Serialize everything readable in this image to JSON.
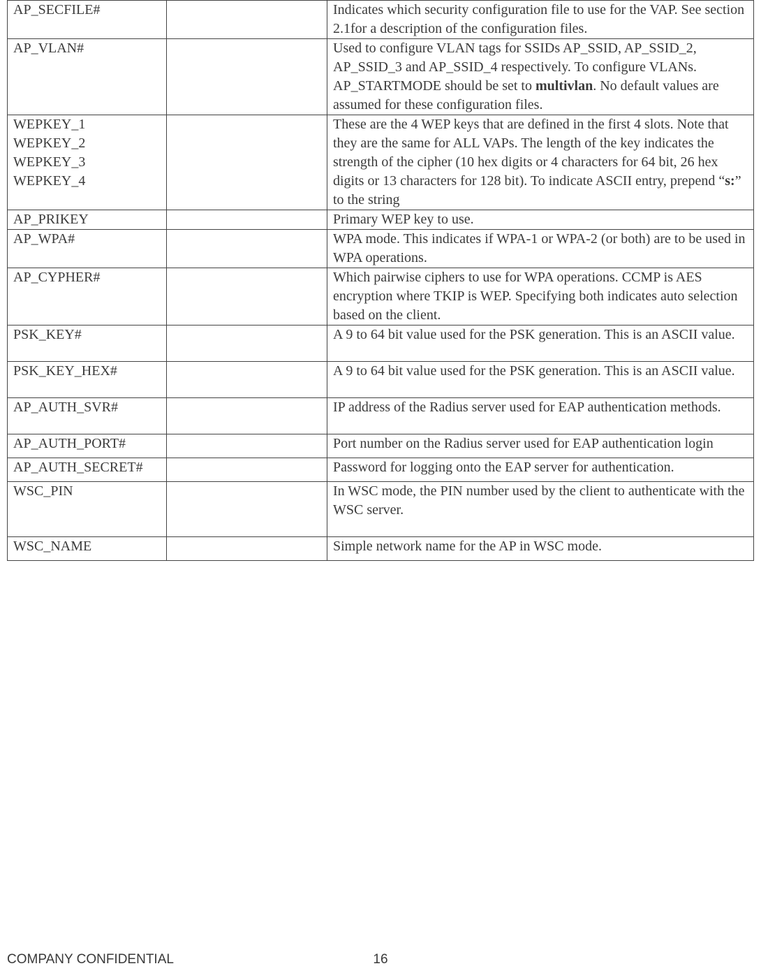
{
  "rows": [
    {
      "key": "AP_SECFILE#",
      "desc_html": "Indicates which security configuration file to use for the VAP. See section 2.1for a description of the configuration files."
    },
    {
      "key": "AP_VLAN#",
      "desc_html": "Used to configure VLAN tags for SSIDs AP_SSID, AP_SSID_2, AP_SSID_3 and AP_SSID_4 respectively. To configure VLANs. AP_STARTMODE should be set to <span class=\"bold\">multivlan</span>. No default values are assumed for these configuration files."
    },
    {
      "key_html": "<div>WEPKEY_1</div><div>WEPKEY_2</div><div>WEPKEY_3</div><div>WEPKEY_4</div>",
      "desc_html": "These are the 4 WEP keys that are defined in the first 4 slots. Note that they are the same for ALL VAPs. The length of the key indicates the strength of the cipher (10 hex digits or 4 characters for 64 bit, 26 hex digits or 13 characters for 128 bit). To indicate ASCII entry, prepend &ldquo;<span class=\"bold\">s:</span>&rdquo; to the string"
    },
    {
      "key": "AP_PRIKEY",
      "desc_html": "Primary WEP key to use."
    },
    {
      "key": "AP_WPA#",
      "desc_html": "WPA mode. This indicates if WPA-1 or WPA-2 (or both) are to be used in WPA operations."
    },
    {
      "key": "AP_CYPHER#",
      "desc_html": "Which pairwise ciphers to use for WPA operations. CCMP is AES encryption where TKIP is WEP. Specifying both indicates auto selection based on the client."
    },
    {
      "key": "PSK_KEY#",
      "desc_html": "A 9 to 64 bit value used for the PSK generation. This is an ASCII value.",
      "extra": true
    },
    {
      "key": "PSK_KEY_HEX#",
      "desc_html": "A 9 to 64 bit value used for the PSK generation. This is an ASCII value.",
      "extra": true
    },
    {
      "key": "AP_AUTH_SVR#",
      "desc_html": "IP address of the Radius server used for EAP authentication methods.",
      "extra": true
    },
    {
      "key": "AP_AUTH_PORT#",
      "desc_html": "Port number on the Radius server used for EAP authentication login",
      "small": true
    },
    {
      "key": "AP_AUTH_SECRET#",
      "desc_html": "Password for logging onto the EAP server for authentication.",
      "small": true
    },
    {
      "key": "WSC_PIN",
      "desc_html": "In WSC mode, the PIN number used by the client to authenticate with the WSC server.",
      "extra": true
    },
    {
      "key": "WSC_NAME",
      "desc_html": "Simple network name for the AP in WSC mode.",
      "small": true
    }
  ],
  "footer": {
    "left": "COMPANY CONFIDENTIAL",
    "center": "16"
  }
}
